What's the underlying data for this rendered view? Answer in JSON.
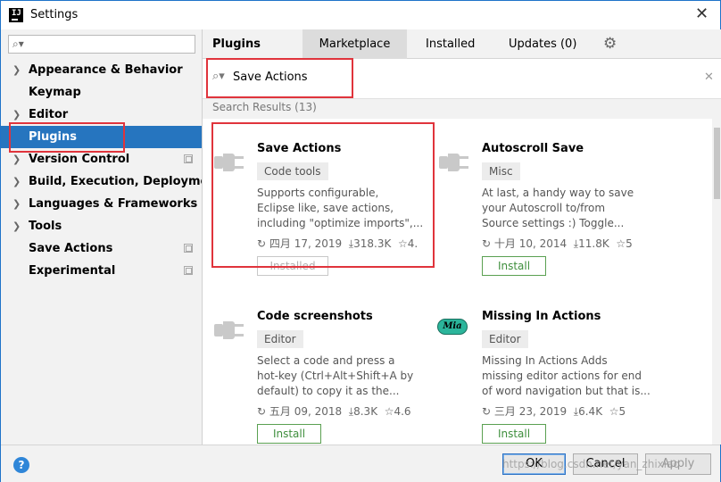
{
  "window": {
    "title": "Settings",
    "app_icon_text": "IJ"
  },
  "sidebar": {
    "items": [
      {
        "label": "Appearance & Behavior",
        "arrow": true
      },
      {
        "label": "Keymap"
      },
      {
        "label": "Editor",
        "arrow": true
      },
      {
        "label": "Plugins",
        "selected": true
      },
      {
        "label": "Version Control",
        "arrow": true,
        "copy": true
      },
      {
        "label": "Build, Execution, Deployment",
        "arrow": true
      },
      {
        "label": "Languages & Frameworks",
        "arrow": true
      },
      {
        "label": "Tools",
        "arrow": true
      },
      {
        "label": "Save Actions",
        "copy": true
      },
      {
        "label": "Experimental",
        "copy": true
      }
    ]
  },
  "tabs": {
    "plugins": "Plugins",
    "marketplace": "Marketplace",
    "installed": "Installed",
    "updates": "Updates (0)"
  },
  "search": {
    "value": "Save Actions"
  },
  "results_header": "Search Results (13)",
  "plugins": [
    {
      "name": "Save Actions",
      "tag": "Code tools",
      "desc": [
        "Supports configurable,",
        "Eclipse like, save actions,",
        "including \"optimize imports\",..."
      ],
      "date": "四月 17, 2019",
      "downloads": "318.3K",
      "rating": "4.",
      "button": "Installed"
    },
    {
      "name": "Autoscroll Save",
      "tag": "Misc",
      "desc": [
        "At last, a handy way to save",
        "your Autoscroll to/from",
        "Source settings :) Toggle..."
      ],
      "date": "十月 10, 2014",
      "downloads": "11.8K",
      "rating": "5",
      "button": "Install"
    },
    {
      "name": "Code screenshots",
      "tag": "Editor",
      "desc": [
        "Select a code and press a",
        "hot-key (Ctrl+Alt+Shift+A by",
        "default) to copy it as the..."
      ],
      "date": "五月 09, 2018",
      "downloads": "8.3K",
      "rating": "4.6",
      "button": "Install"
    },
    {
      "name": "Missing In Actions",
      "tag": "Editor",
      "desc": [
        "Missing In Actions Adds",
        "missing editor actions for end",
        "of word navigation but that is..."
      ],
      "date": "三月 23, 2019",
      "downloads": "6.4K",
      "rating": "5",
      "button": "Install",
      "icon_text": "Mia"
    }
  ],
  "footer": {
    "help": "?",
    "ok": "OK",
    "cancel": "Cancel",
    "apply": "Apply",
    "watermark": "https://blog.csdn.net/yan_zhixiao"
  },
  "colors": {
    "selection": "#2675bf",
    "annotation_red": "#e0343c",
    "install_green": "#3e8e3c"
  }
}
